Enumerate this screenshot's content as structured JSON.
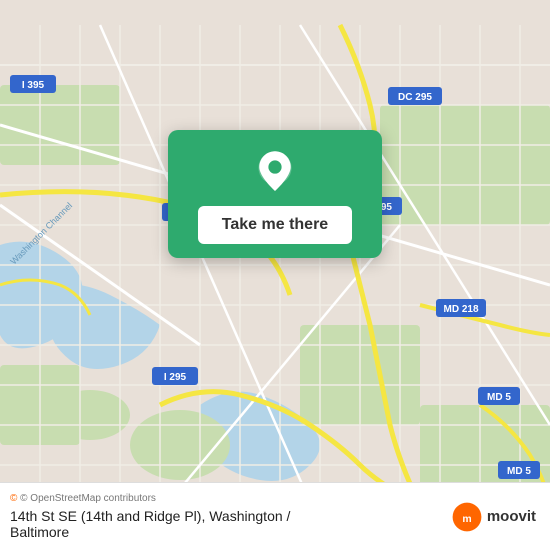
{
  "map": {
    "alt": "Map of Washington DC / Baltimore area showing 14th St SE"
  },
  "card": {
    "button_label": "Take me there"
  },
  "bottom_bar": {
    "attribution": "© OpenStreetMap contributors",
    "location_line1": "14th St SE (14th and Ridge Pl), Washington /",
    "location_line2": "Baltimore",
    "moovit_label": "moovit"
  },
  "colors": {
    "map_bg": "#e8e0d8",
    "card_bg": "#2eaa6e",
    "road_yellow": "#f5e642",
    "road_white": "#ffffff",
    "water": "#b3d4e8",
    "park": "#c8ddb0"
  }
}
